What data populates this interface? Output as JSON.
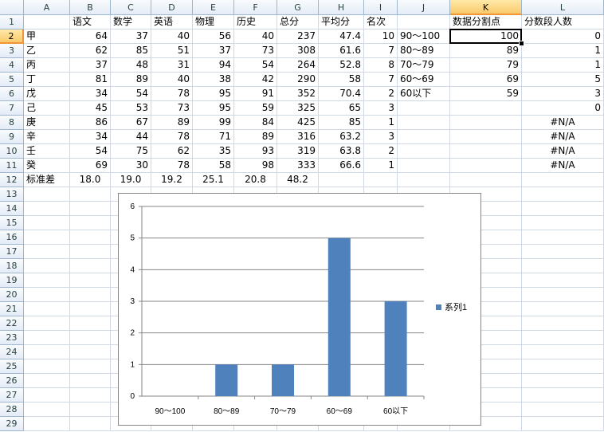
{
  "sheet": {
    "column_headers": [
      "A",
      "B",
      "C",
      "D",
      "E",
      "F",
      "G",
      "H",
      "I",
      "J",
      "K",
      "L"
    ],
    "row_headers": [
      "1",
      "2",
      "3",
      "4",
      "5",
      "6",
      "7",
      "8",
      "9",
      "10",
      "11",
      "12",
      "13",
      "14",
      "15",
      "16",
      "17",
      "18",
      "19",
      "20",
      "21",
      "22",
      "23",
      "24",
      "25",
      "26",
      "27",
      "28",
      "29"
    ],
    "selected_column": "K",
    "selected_row": "2",
    "header_row": [
      "",
      "语文",
      "数学",
      "英语",
      "物理",
      "历史",
      "总分",
      "平均分",
      "名次",
      "",
      "数据分割点",
      "分数段人数"
    ],
    "rows": [
      [
        "甲",
        "64",
        "37",
        "40",
        "56",
        "40",
        "237",
        "47.4",
        "10",
        "90～100",
        "100",
        "0"
      ],
      [
        "乙",
        "62",
        "85",
        "51",
        "37",
        "73",
        "308",
        "61.6",
        "7",
        "80～89",
        "89",
        "1"
      ],
      [
        "丙",
        "37",
        "48",
        "31",
        "94",
        "54",
        "264",
        "52.8",
        "8",
        "70～79",
        "79",
        "1"
      ],
      [
        "丁",
        "81",
        "89",
        "40",
        "38",
        "42",
        "290",
        "58",
        "7",
        "60～69",
        "69",
        "5"
      ],
      [
        "戊",
        "34",
        "54",
        "78",
        "95",
        "91",
        "352",
        "70.4",
        "2",
        "60以下",
        "59",
        "3"
      ],
      [
        "己",
        "45",
        "53",
        "73",
        "95",
        "59",
        "325",
        "65",
        "3",
        "",
        "",
        "0"
      ],
      [
        "庚",
        "86",
        "67",
        "89",
        "99",
        "84",
        "425",
        "85",
        "1",
        "",
        "",
        "#N/A"
      ],
      [
        "辛",
        "34",
        "44",
        "78",
        "71",
        "89",
        "316",
        "63.2",
        "3",
        "",
        "",
        "#N/A"
      ],
      [
        "壬",
        "54",
        "75",
        "62",
        "35",
        "93",
        "319",
        "63.8",
        "2",
        "",
        "",
        "#N/A"
      ],
      [
        "癸",
        "69",
        "30",
        "78",
        "58",
        "98",
        "333",
        "66.6",
        "1",
        "",
        "",
        "#N/A"
      ],
      [
        "标准差",
        "18.0",
        "19.0",
        "19.2",
        "25.1",
        "20.8",
        "48.2",
        "",
        "",
        "",
        "",
        ""
      ]
    ]
  },
  "chart_data": {
    "type": "bar",
    "categories": [
      "90～100",
      "80～89",
      "70～79",
      "60～69",
      "60以下"
    ],
    "series": [
      {
        "name": "系列1",
        "values": [
          0,
          1,
          1,
          5,
          3
        ]
      }
    ],
    "ylim": [
      0,
      6
    ],
    "yticks": [
      "0",
      "1",
      "2",
      "3",
      "4",
      "5",
      "6"
    ],
    "grid": true,
    "legend": "right",
    "color": "#4f81bd"
  }
}
